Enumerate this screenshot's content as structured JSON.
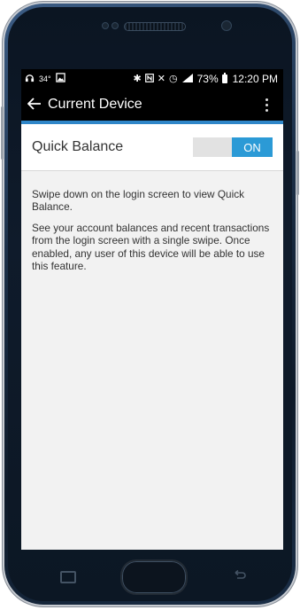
{
  "status_bar": {
    "temperature": "34°",
    "battery_percent": "73%",
    "time": "12:20 PM"
  },
  "app_bar": {
    "title": "Current Device"
  },
  "setting": {
    "label": "Quick Balance",
    "toggle_state": "ON"
  },
  "description": {
    "paragraph1": "Swipe down on the login screen to view Quick Balance.",
    "paragraph2": "See your account balances and recent transactions from the login screen with a single swipe. Once enabled, any user of this device will be able to use this feature."
  },
  "colors": {
    "accent": "#2b9ad6",
    "appbar_underline": "#2f86c8",
    "screen_bg": "#f2f2f2"
  },
  "icons": {
    "status_left": [
      "headphones-icon",
      "image-icon"
    ],
    "status_right": [
      "bluetooth-icon",
      "nfc-icon",
      "mute-icon",
      "alarm-icon",
      "signal-icon",
      "battery-icon"
    ],
    "app_bar": [
      "back-arrow-icon",
      "overflow-menu-icon"
    ],
    "nav": [
      "recent-apps-icon",
      "home-button",
      "back-icon"
    ]
  }
}
